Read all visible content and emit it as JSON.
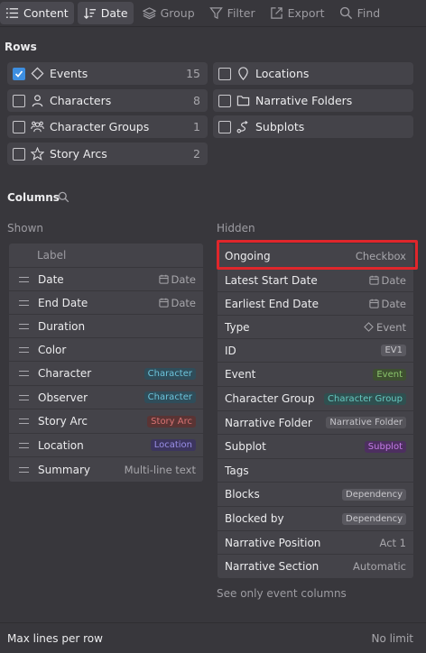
{
  "toolbar": {
    "content_label": "Content",
    "date_label": "Date",
    "group_label": "Group",
    "filter_label": "Filter",
    "export_label": "Export",
    "find_label": "Find"
  },
  "rows_section": {
    "title": "Rows",
    "items": [
      {
        "label": "Events",
        "count": "15",
        "checked": true,
        "icon": "diamond-icon"
      },
      {
        "label": "Characters",
        "count": "8",
        "checked": false,
        "icon": "person-icon"
      },
      {
        "label": "Character Groups",
        "count": "1",
        "checked": false,
        "icon": "group-icon"
      },
      {
        "label": "Story Arcs",
        "count": "2",
        "checked": false,
        "icon": "star-icon"
      },
      {
        "label": "Locations",
        "checked": false,
        "icon": "map-pin-icon"
      },
      {
        "label": "Narrative Folders",
        "checked": false,
        "icon": "folder-icon"
      },
      {
        "label": "Subplots",
        "checked": false,
        "icon": "subplot-icon"
      }
    ]
  },
  "columns_section": {
    "title": "Columns",
    "shown_header": "Shown",
    "hidden_header": "Hidden",
    "shown_label_header": "Label",
    "shown": [
      {
        "name": "Date",
        "type": "Date"
      },
      {
        "name": "End Date",
        "type": "Date"
      },
      {
        "name": "Duration",
        "type": ""
      },
      {
        "name": "Color",
        "type": ""
      },
      {
        "name": "Character",
        "tag": "Character"
      },
      {
        "name": "Observer",
        "tag": "Character"
      },
      {
        "name": "Story Arc",
        "tag": "Story Arc"
      },
      {
        "name": "Location",
        "tag": "Location"
      },
      {
        "name": "Summary",
        "type": "Multi-line text"
      }
    ],
    "hidden": [
      {
        "name": "Ongoing",
        "type": "Checkbox"
      },
      {
        "name": "Latest Start Date",
        "type": "Date"
      },
      {
        "name": "Earliest End Date",
        "type": "Date"
      },
      {
        "name": "Type",
        "type": "Event"
      },
      {
        "name": "ID",
        "tag": "EV1"
      },
      {
        "name": "Event",
        "tag": "Event"
      },
      {
        "name": "Character Group",
        "tag": "Character Group"
      },
      {
        "name": "Narrative Folder",
        "tag": "Narrative Folder"
      },
      {
        "name": "Subplot",
        "tag": "Subplot"
      },
      {
        "name": "Tags",
        "type": ""
      },
      {
        "name": "Blocks",
        "tag": "Dependency"
      },
      {
        "name": "Blocked by",
        "tag": "Dependency"
      },
      {
        "name": "Narrative Position",
        "type": "Act 1"
      },
      {
        "name": "Narrative Section",
        "type": "Automatic"
      }
    ],
    "see_only_link": "See only event columns"
  },
  "footer": {
    "label": "Max lines per row",
    "value": "No limit"
  },
  "colors": {
    "accent": "#3d8ee0",
    "highlight": "#e0262b",
    "background": "#38373c"
  }
}
